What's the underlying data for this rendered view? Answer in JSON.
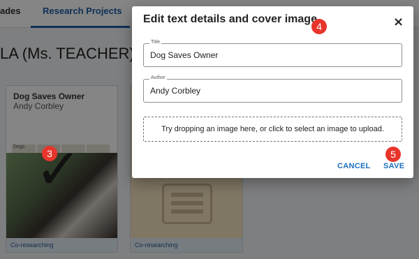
{
  "nav": {
    "tabs": [
      {
        "label": "ades"
      },
      {
        "label": "Research Projects"
      }
    ]
  },
  "page": {
    "class_title": "LA (Ms. TEACHER)"
  },
  "cards": [
    {
      "title": "Dog Saves Owner",
      "author": "Andy Corbley",
      "strip_label": "Dogs",
      "footer": "Co-researching"
    },
    {
      "footer": "Co-researching"
    }
  ],
  "annotations": {
    "step3": "3",
    "step4": "4",
    "step5": "5",
    "checkmark": "✓"
  },
  "dialog": {
    "title": "Edit text details and cover image",
    "close_icon": "×",
    "fields": {
      "title": {
        "label": "Title",
        "value": "Dog Saves Owner"
      },
      "author": {
        "label": "Author",
        "value": "Andy Corbley"
      }
    },
    "dropzone_text": "Try dropping an image here, or click to select an image to upload.",
    "cancel_label": "CANCEL",
    "save_label": "SAVE"
  },
  "colors": {
    "accent": "#1b6fbf",
    "badge": "#e8352b"
  }
}
